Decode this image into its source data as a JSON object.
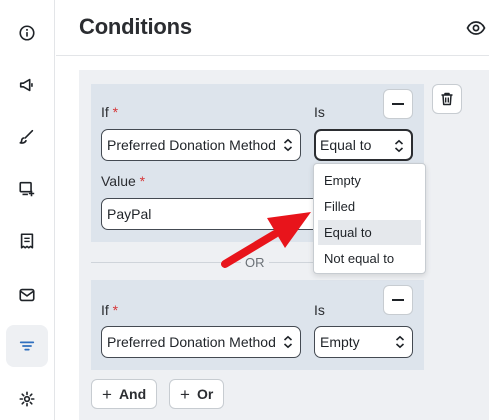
{
  "header": {
    "title": "Conditions"
  },
  "sidebar": {
    "items": [
      {
        "icon": "info-icon"
      },
      {
        "icon": "megaphone-icon"
      },
      {
        "icon": "brush-icon"
      },
      {
        "icon": "add-card-icon"
      },
      {
        "icon": "receipt-icon"
      },
      {
        "icon": "mail-icon"
      },
      {
        "icon": "filter-lines-icon",
        "active": true
      },
      {
        "icon": "gear-icon"
      }
    ]
  },
  "rules": [
    {
      "if_label": "If",
      "required_mark": "*",
      "is_label": "Is",
      "field_value": "Preferred Donation Method",
      "operator_value": "Equal to",
      "value_label": "Value",
      "value": "PayPal"
    },
    {
      "if_label": "If",
      "required_mark": "*",
      "is_label": "Is",
      "field_value": "Preferred Donation Method",
      "operator_value": "Empty"
    }
  ],
  "or_separator": "OR",
  "operator_dropdown": {
    "options": [
      "Empty",
      "Filled",
      "Equal to",
      "Not equal to"
    ],
    "selected": "Equal to"
  },
  "buttons": {
    "and_label": "And",
    "or_label": "Or",
    "plus": "+"
  },
  "colors": {
    "accent": "#2f6fbf",
    "arrow": "#e8141b",
    "required": "#d63638"
  }
}
